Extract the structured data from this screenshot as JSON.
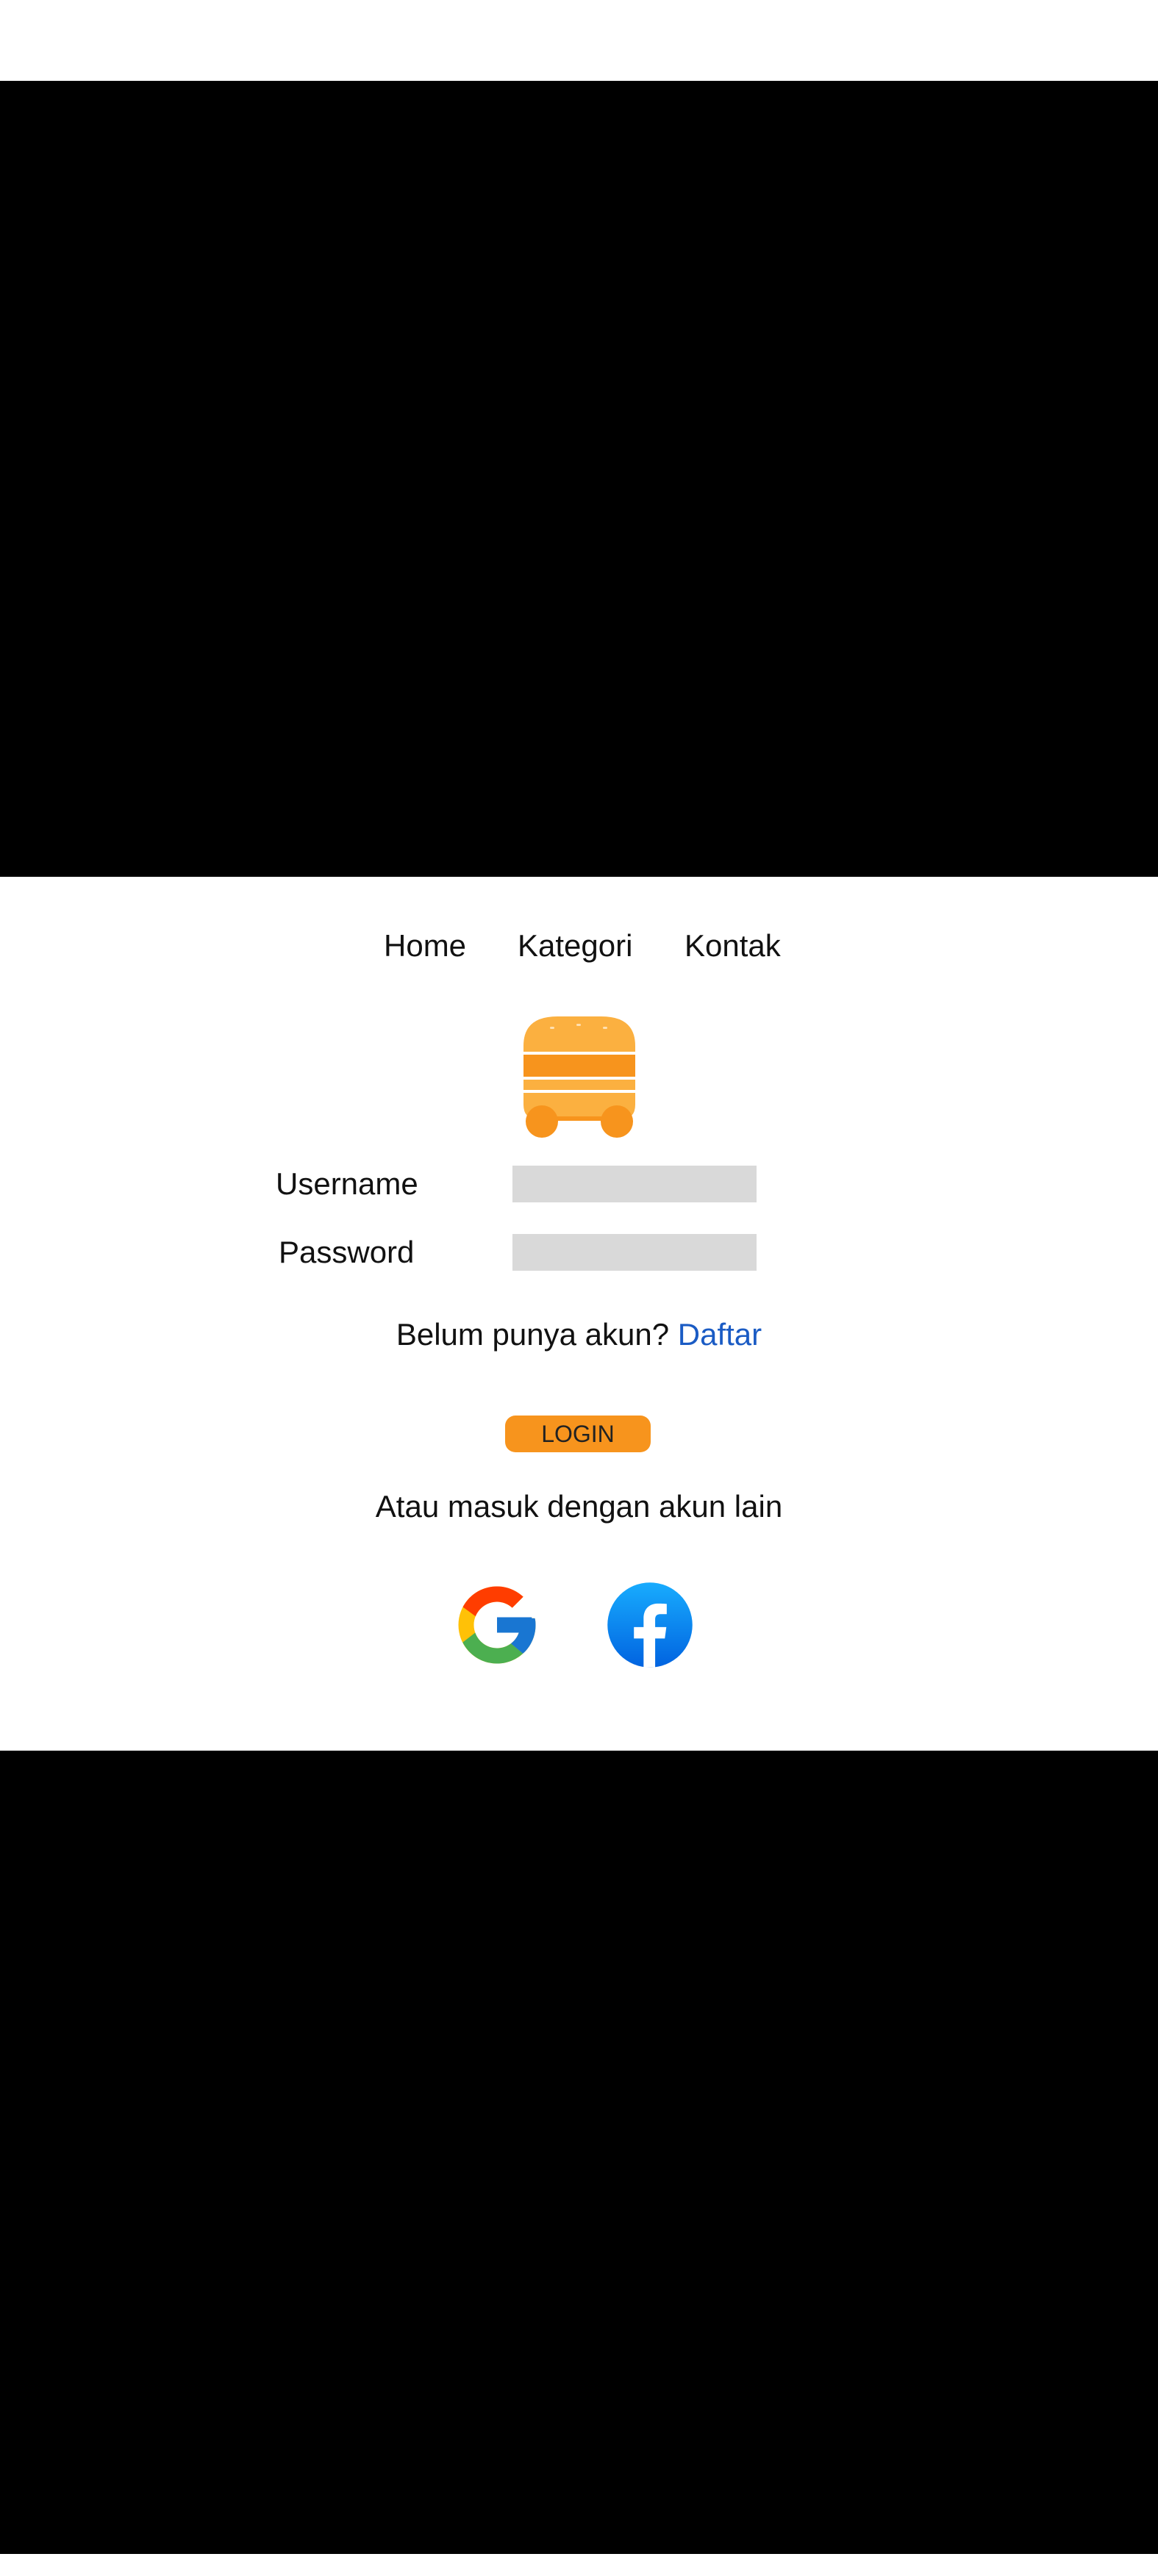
{
  "nav": {
    "items": [
      {
        "label": "Home"
      },
      {
        "label": "Kategori"
      },
      {
        "label": "Kontak"
      }
    ]
  },
  "logo": {
    "icon": "burger-cart-icon",
    "colors": {
      "light": "#fbb040",
      "dark": "#f7941d"
    }
  },
  "form": {
    "username_label": "Username",
    "username_value": "",
    "password_label": "Password",
    "password_value": ""
  },
  "register": {
    "prompt": "Belum punya akun? ",
    "link_label": "Daftar",
    "link_color": "#1a5bc4"
  },
  "login": {
    "button_label": "LOGIN",
    "button_color": "#f7941d"
  },
  "alt_login": {
    "text": "Atau masuk dengan akun lain",
    "providers": [
      {
        "icon": "google-icon"
      },
      {
        "icon": "facebook-icon",
        "color": "#1877f2"
      }
    ]
  }
}
